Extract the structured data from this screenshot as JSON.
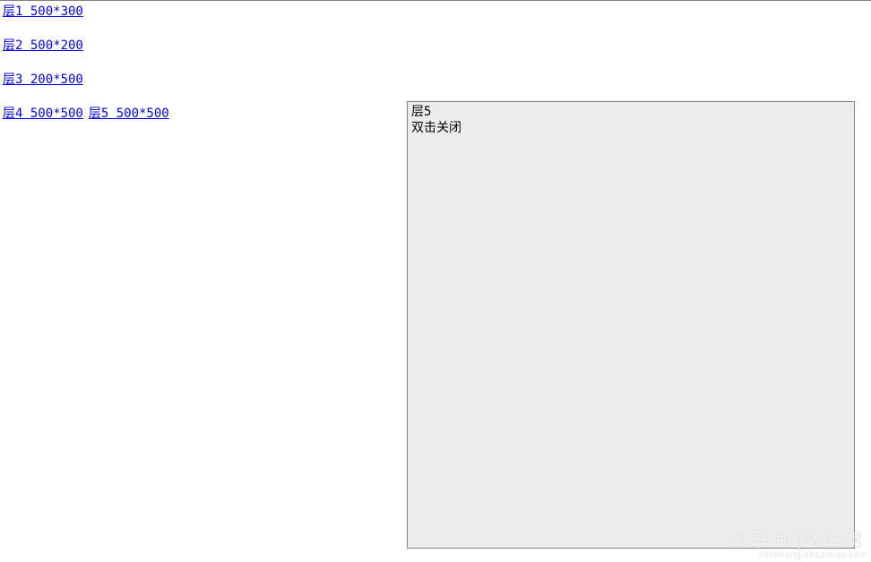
{
  "links": {
    "row1": {
      "label": "层1 500*300"
    },
    "row2": {
      "label": "层2 500*200"
    },
    "row3": {
      "label": "层3 200*500"
    },
    "row4a": {
      "label": "层4 500*500"
    },
    "row4b": {
      "label": "层5 500*500"
    }
  },
  "panel": {
    "title": "层5",
    "hint": "双击关闭"
  },
  "watermark": {
    "brand": "查字典",
    "section": "教程网",
    "url": "jiaocheng.chazidian.com"
  }
}
